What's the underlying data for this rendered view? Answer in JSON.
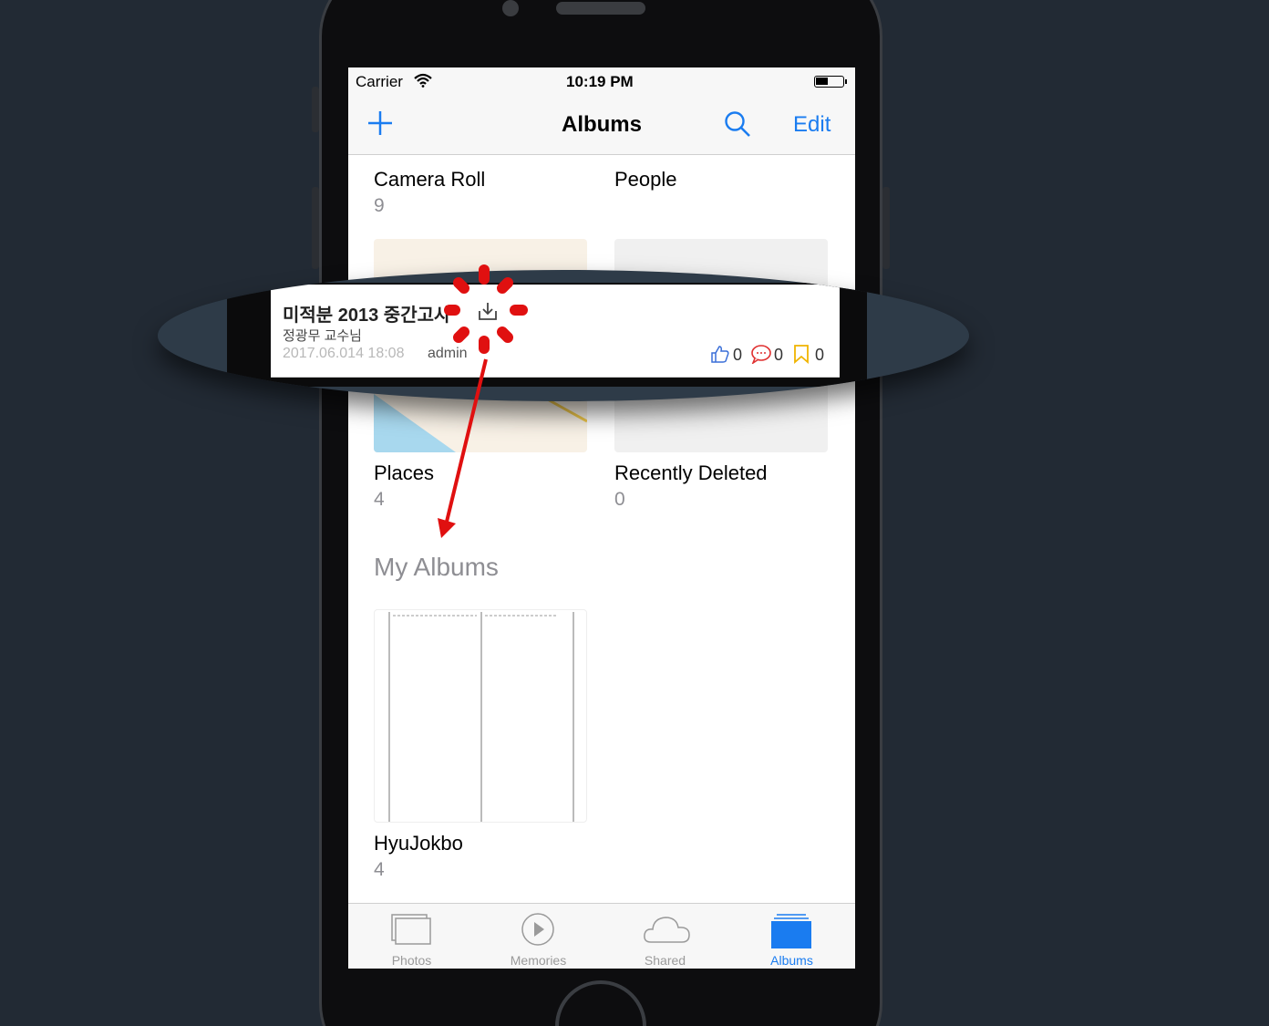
{
  "status_bar": {
    "carrier": "Carrier",
    "time": "10:19 PM"
  },
  "nav": {
    "title": "Albums",
    "edit": "Edit"
  },
  "albums": [
    {
      "name": "Camera Roll",
      "count": "9"
    },
    {
      "name": "People",
      "count": ""
    },
    {
      "name": "Places",
      "count": "4"
    },
    {
      "name": "Recently Deleted",
      "count": "0"
    }
  ],
  "my_albums": {
    "title": "My Albums",
    "items": [
      {
        "name": "HyuJokbo",
        "count": "4"
      }
    ]
  },
  "tabs": [
    {
      "label": "Photos",
      "icon": "photos-icon",
      "active": false
    },
    {
      "label": "Memories",
      "icon": "memories-icon",
      "active": false
    },
    {
      "label": "Shared",
      "icon": "shared-cloud-icon",
      "active": false
    },
    {
      "label": "Albums",
      "icon": "albums-icon",
      "active": true
    }
  ],
  "zoom_card": {
    "title": "미적분 2013 중간고사",
    "author": "정광무 교수님",
    "date": "2017.06.014 18:08",
    "user": "admin",
    "likes": "0",
    "comments": "0",
    "bookmarks": "0"
  },
  "colors": {
    "accent": "#1a7cf0",
    "annotation": "#e01010",
    "background": "#222a34"
  }
}
